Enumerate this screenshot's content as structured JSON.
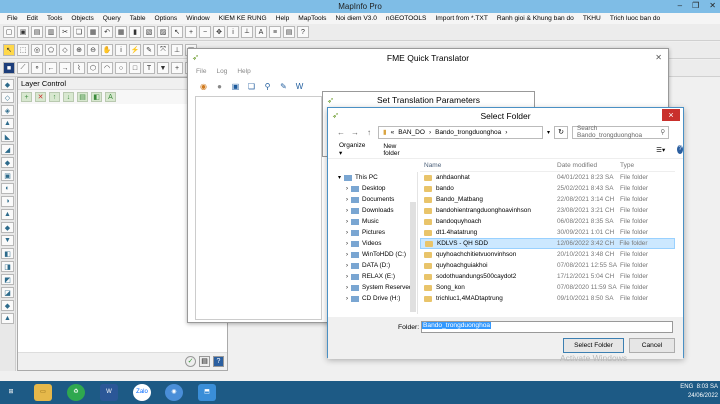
{
  "mapinfo": {
    "title": "MapInfo Pro",
    "menu": [
      "File",
      "Edit",
      "Tools",
      "Objects",
      "Query",
      "Table",
      "Options",
      "Window",
      "KIEM KE RUNG",
      "Help",
      "MapTools",
      "Noi diem V3.0",
      "nGEOTOOLS",
      "Import from *.TXT",
      "Ranh gioi & Khung ban do",
      "TKHU",
      "Trich luoc ban do"
    ]
  },
  "layer_control": {
    "title": "Layer Control"
  },
  "fme": {
    "title": "FME Quick Translator",
    "menu": [
      "File",
      "Log",
      "Help"
    ]
  },
  "stp": {
    "title": "Set Translation Parameters"
  },
  "dialog": {
    "title": "Select Folder",
    "close_label": "×",
    "breadcrumb": [
      "BAN_DO",
      "Bando_trongduonghoa"
    ],
    "search_placeholder": "Search Bando_trongduonghoa",
    "organize": "Organize ▾",
    "new_folder": "New folder",
    "nav_tree": [
      "This PC",
      "Desktop",
      "Documents",
      "Downloads",
      "Music",
      "Pictures",
      "Videos",
      "WinToHDD (C:)",
      "DATA (D:)",
      "RELAX (E:)",
      "System Reserved",
      "CD Drive (H:)"
    ],
    "columns": {
      "name": "Name",
      "date": "Date modified",
      "type": "Type"
    },
    "rows": [
      {
        "name": "anhdaonhat",
        "date": "04/01/2021 8:23 SA",
        "type": "File folder"
      },
      {
        "name": "bando",
        "date": "25/02/2021 8:43 SA",
        "type": "File folder"
      },
      {
        "name": "Bando_Matbang",
        "date": "22/08/2021 3:14 CH",
        "type": "File folder"
      },
      {
        "name": "bandohientrangduonghoavinhson",
        "date": "23/08/2021 3:21 CH",
        "type": "File folder"
      },
      {
        "name": "bandoquyhoach",
        "date": "06/08/2021 8:35 SA",
        "type": "File folder"
      },
      {
        "name": "dt1.4hatatrung",
        "date": "30/09/2021 1:01 CH",
        "type": "File folder"
      },
      {
        "name": "KDLVS - QH SDD",
        "date": "12/06/2022 3:42 CH",
        "type": "File folder"
      },
      {
        "name": "quyhoachchitietvuonvinhson",
        "date": "20/10/2021 3:48 CH",
        "type": "File folder"
      },
      {
        "name": "quyhoachguiakhoi",
        "date": "07/08/2021 12:55 SA",
        "type": "File folder"
      },
      {
        "name": "sodothuandungs500caydot2",
        "date": "17/12/2021 5:04 CH",
        "type": "File folder"
      },
      {
        "name": "Song_kon",
        "date": "07/08/2020 11:59 SA",
        "type": "File folder"
      },
      {
        "name": "trichluc1,4MADtaptrung",
        "date": "09/10/2021 8:50 SA",
        "type": "File folder"
      }
    ],
    "folder_label": "Folder:",
    "folder_value": "Bando_trongduonghoa",
    "select_btn": "Select Folder",
    "cancel_btn": "Cancel",
    "watermark": "Activate Windows"
  },
  "taskbar": {
    "lang": "ENG",
    "time": "8:03 SA",
    "date": "24/06/2022"
  }
}
